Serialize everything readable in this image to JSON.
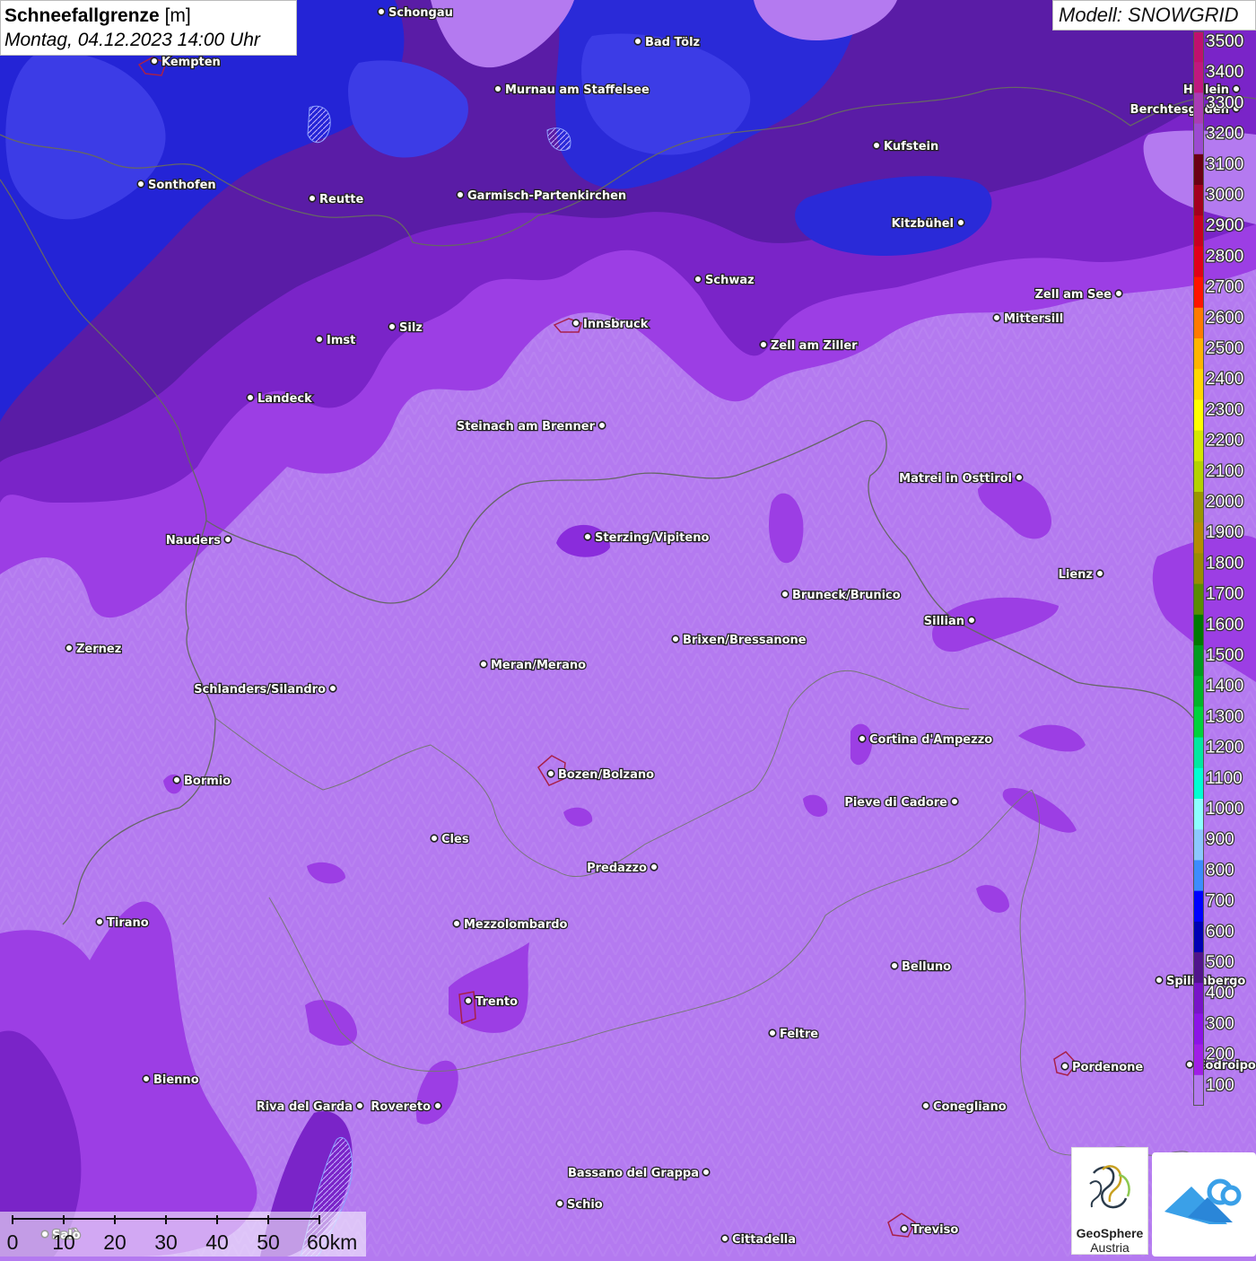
{
  "header": {
    "title_bold": "Schneefallgrenze",
    "title_unit": "[m]",
    "subtitle": "Montag, 04.12.2023 14:00 Uhr"
  },
  "model_label": "Modell: SNOWGRID",
  "legend": {
    "levels": [
      "3500",
      "3400",
      "3300",
      "3200",
      "3100",
      "3000",
      "2900",
      "2800",
      "2700",
      "2600",
      "2500",
      "2400",
      "2300",
      "2200",
      "2100",
      "2000",
      "1900",
      "1800",
      "1700",
      "1600",
      "1500",
      "1400",
      "1300",
      "1200",
      "1100",
      "1000",
      "900",
      "800",
      "700",
      "600",
      "500",
      "400",
      "300",
      "200",
      "100"
    ],
    "colors": [
      "#c0106e",
      "#c0187e",
      "#a93cb4",
      "#9b4ad0",
      "#6b0014",
      "#a3001e",
      "#c8001e",
      "#e00018",
      "#ff1400",
      "#ff7a00",
      "#ffb400",
      "#ffd800",
      "#ffff00",
      "#d4e800",
      "#b4d200",
      "#9a9600",
      "#b48c00",
      "#9a8c00",
      "#5a8c00",
      "#007800",
      "#009a1e",
      "#00b428",
      "#00d23c",
      "#00e8a0",
      "#00ffd2",
      "#8cffff",
      "#8cc8ff",
      "#3c8cff",
      "#0000ff",
      "#0000b4",
      "#50148c",
      "#7814c8",
      "#8c14e6",
      "#a01ee6",
      "#b47af0"
    ]
  },
  "cities": [
    {
      "name": "Schongau"
    },
    {
      "name": "Kempten"
    },
    {
      "name": "Bad Tölz"
    },
    {
      "name": "Murnau am Staffelsee"
    },
    {
      "name": "Hallein"
    },
    {
      "name": "Berchtesgaden"
    },
    {
      "name": "Kufstein"
    },
    {
      "name": "Sonthofen"
    },
    {
      "name": "Reutte"
    },
    {
      "name": "Garmisch-Partenkirchen"
    },
    {
      "name": "Kitzbühel"
    },
    {
      "name": "Schwaz"
    },
    {
      "name": "Zell am See"
    },
    {
      "name": "Mittersill"
    },
    {
      "name": "Innsbruck"
    },
    {
      "name": "Silz"
    },
    {
      "name": "Imst"
    },
    {
      "name": "Zell am Ziller"
    },
    {
      "name": "Landeck"
    },
    {
      "name": "Steinach am Brenner"
    },
    {
      "name": "Matrei in Osttirol"
    },
    {
      "name": "Nauders"
    },
    {
      "name": "Sterzing/Vipiteno"
    },
    {
      "name": "Lienz"
    },
    {
      "name": "Bruneck/Brunico"
    },
    {
      "name": "Sillian"
    },
    {
      "name": "Zernez"
    },
    {
      "name": "Brixen/Bressanone"
    },
    {
      "name": "Meran/Merano"
    },
    {
      "name": "Schlanders/Silandro"
    },
    {
      "name": "Cortina d'Ampezzo"
    },
    {
      "name": "Bozen/Bolzano"
    },
    {
      "name": "Bormio"
    },
    {
      "name": "Pieve di Cadore"
    },
    {
      "name": "Cles"
    },
    {
      "name": "Predazzo"
    },
    {
      "name": "Tirano"
    },
    {
      "name": "Mezzolombardo"
    },
    {
      "name": "Belluno"
    },
    {
      "name": "Spilimbergo"
    },
    {
      "name": "Trento"
    },
    {
      "name": "Feltre"
    },
    {
      "name": "Bienno"
    },
    {
      "name": "Pordenone"
    },
    {
      "name": "Codroipo"
    },
    {
      "name": "Riva del Garda"
    },
    {
      "name": "Rovereto"
    },
    {
      "name": "Conegliano"
    },
    {
      "name": "Bassano del Grappa"
    },
    {
      "name": "Schio"
    },
    {
      "name": "Treviso"
    },
    {
      "name": "Cittadella"
    },
    {
      "name": "Salò"
    }
  ],
  "scale": {
    "ticks": [
      "0",
      "10",
      "20",
      "30",
      "40",
      "50",
      "60km"
    ]
  },
  "logo": {
    "line1": "GeoSphere",
    "line2": "Austria"
  }
}
